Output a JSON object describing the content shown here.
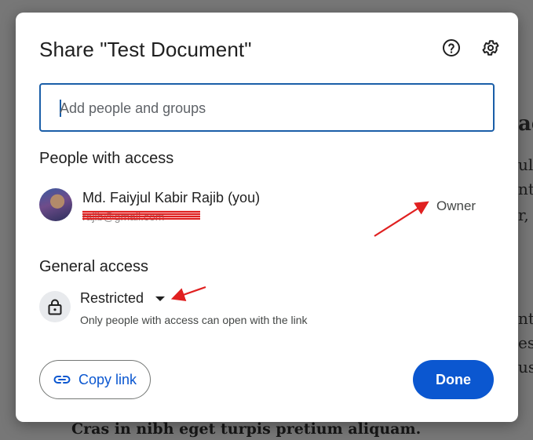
{
  "background": {
    "partial_lines": [
      "ac",
      "ul",
      "nt",
      "r,",
      "nt",
      "es",
      "us"
    ],
    "bottom_line": "Cras in nibh eget turpis pretium aliquam."
  },
  "dialog": {
    "title": "Share \"Test Document\"",
    "help_icon": "help-circle-icon",
    "settings_icon": "gear-icon",
    "search": {
      "placeholder": "Add people and groups",
      "value": ""
    },
    "people_section": {
      "label": "People with access",
      "people": [
        {
          "name": "Md. Faiyjul Kabir Rajib (you)",
          "email": "rajib@gmail.com",
          "role": "Owner"
        }
      ]
    },
    "general_access": {
      "label": "General access",
      "value": "Restricted",
      "description": "Only people with access can open with the link",
      "icon": "lock-icon"
    },
    "footer": {
      "copy_link": "Copy link",
      "copy_icon": "link-icon",
      "done": "Done"
    }
  },
  "colors": {
    "accent": "#0b57d0",
    "focus_border": "#1a5ea8",
    "annotation": "#e02020"
  }
}
